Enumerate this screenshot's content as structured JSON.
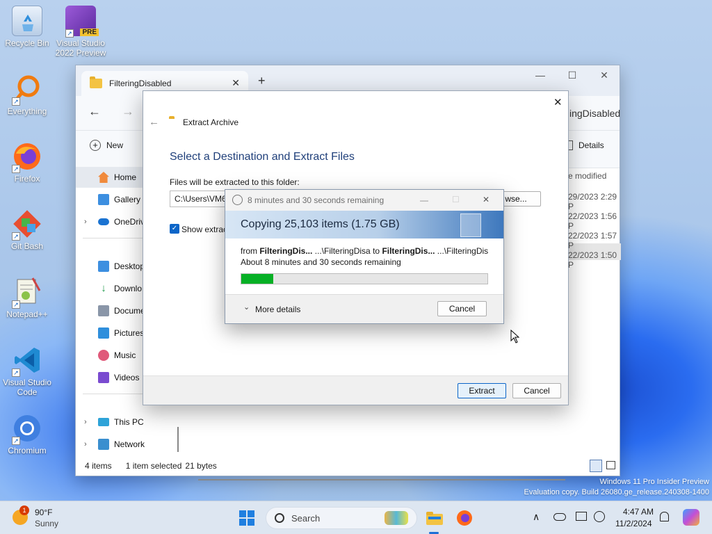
{
  "desktop": {
    "icons": [
      {
        "label": "Recycle Bin",
        "icon": "recycle-bin-icon"
      },
      {
        "label": "Visual Studio 2022 Preview",
        "icon": "visual-studio-preview-icon",
        "badge": "PRE"
      },
      {
        "label": "Everything",
        "icon": "everything-search-icon"
      },
      {
        "label": "Firefox",
        "icon": "firefox-icon"
      },
      {
        "label": "Git Bash",
        "icon": "git-bash-icon"
      },
      {
        "label": "Notepad++",
        "icon": "notepadpp-icon"
      },
      {
        "label": "Visual Studio Code",
        "icon": "vscode-icon"
      },
      {
        "label": "Chromium",
        "icon": "chromium-icon"
      }
    ],
    "watermark": {
      "line1": "Windows 11 Pro Insider Preview",
      "line2": "Evaluation copy. Build 26080.ge_release.240308-1400"
    }
  },
  "explorer": {
    "tab_title": "FilteringDisabled",
    "close_glyph": "✕",
    "newtab_glyph": "+",
    "window_controls": {
      "minimize": "—",
      "maximize": "☐",
      "close": "✕"
    },
    "nav": {
      "back": "←",
      "forward": "→"
    },
    "address_tail": "ingDisabled",
    "new_label": "New",
    "details_label": "Details",
    "column_header": "e modified",
    "dates": [
      "29/2023 2:29 P",
      "22/2023 1:56 P",
      "22/2023 1:57 P",
      "22/2023 1:50 P"
    ],
    "sidebar": [
      {
        "label": "Home",
        "icon": "home-icon"
      },
      {
        "label": "Gallery",
        "icon": "gallery-icon"
      },
      {
        "label": "OneDriv",
        "icon": "onedrive-icon"
      },
      {
        "label": "Desktop",
        "icon": "desktop-folder-icon"
      },
      {
        "label": "Downlo",
        "icon": "downloads-icon"
      },
      {
        "label": "Docume",
        "icon": "documents-icon"
      },
      {
        "label": "Pictures",
        "icon": "pictures-icon"
      },
      {
        "label": "Music",
        "icon": "music-icon"
      },
      {
        "label": "Videos",
        "icon": "videos-icon"
      },
      {
        "label": "This PC",
        "icon": "this-pc-icon"
      },
      {
        "label": "Network",
        "icon": "network-icon"
      }
    ],
    "status": {
      "items": "4 items",
      "selected": "1 item selected",
      "size": "21 bytes"
    }
  },
  "extract_dialog": {
    "back_glyph": "←",
    "close_glyph": "✕",
    "title": "Extract Archive",
    "heading": "Select a Destination and Extract Files",
    "folder_label": "Files will be extracted to this folder:",
    "path_value": "C:\\Users\\VM6",
    "browse_label": "wse...",
    "show_label": "Show extrac",
    "extract_button": "Extract",
    "cancel_button": "Cancel"
  },
  "copy_dialog": {
    "title": "8 minutes and 30 seconds remaining",
    "controls": {
      "minimize": "—",
      "maximize": "☐",
      "close": "✕"
    },
    "heading": "Copying 25,103 items (1.75 GB)",
    "from_prefix": "from",
    "from_name": "FilteringDis...",
    "from_path": "...\\FilteringDisa",
    "to_prefix": "to",
    "to_name": "FilteringDis...",
    "to_path": "...\\FilteringDisa",
    "remaining": "About 8 minutes and 30 seconds remaining",
    "progress_fraction": 0.13,
    "more_details": "More details",
    "cancel_button": "Cancel",
    "progress_color": "#06b025"
  },
  "taskbar": {
    "weather_temp": "90°F",
    "weather_desc": "Sunny",
    "weather_badge": "1",
    "search_label": "Search",
    "time": "4:47 AM",
    "date": "11/2/2024",
    "tray_chevron": "∧"
  }
}
